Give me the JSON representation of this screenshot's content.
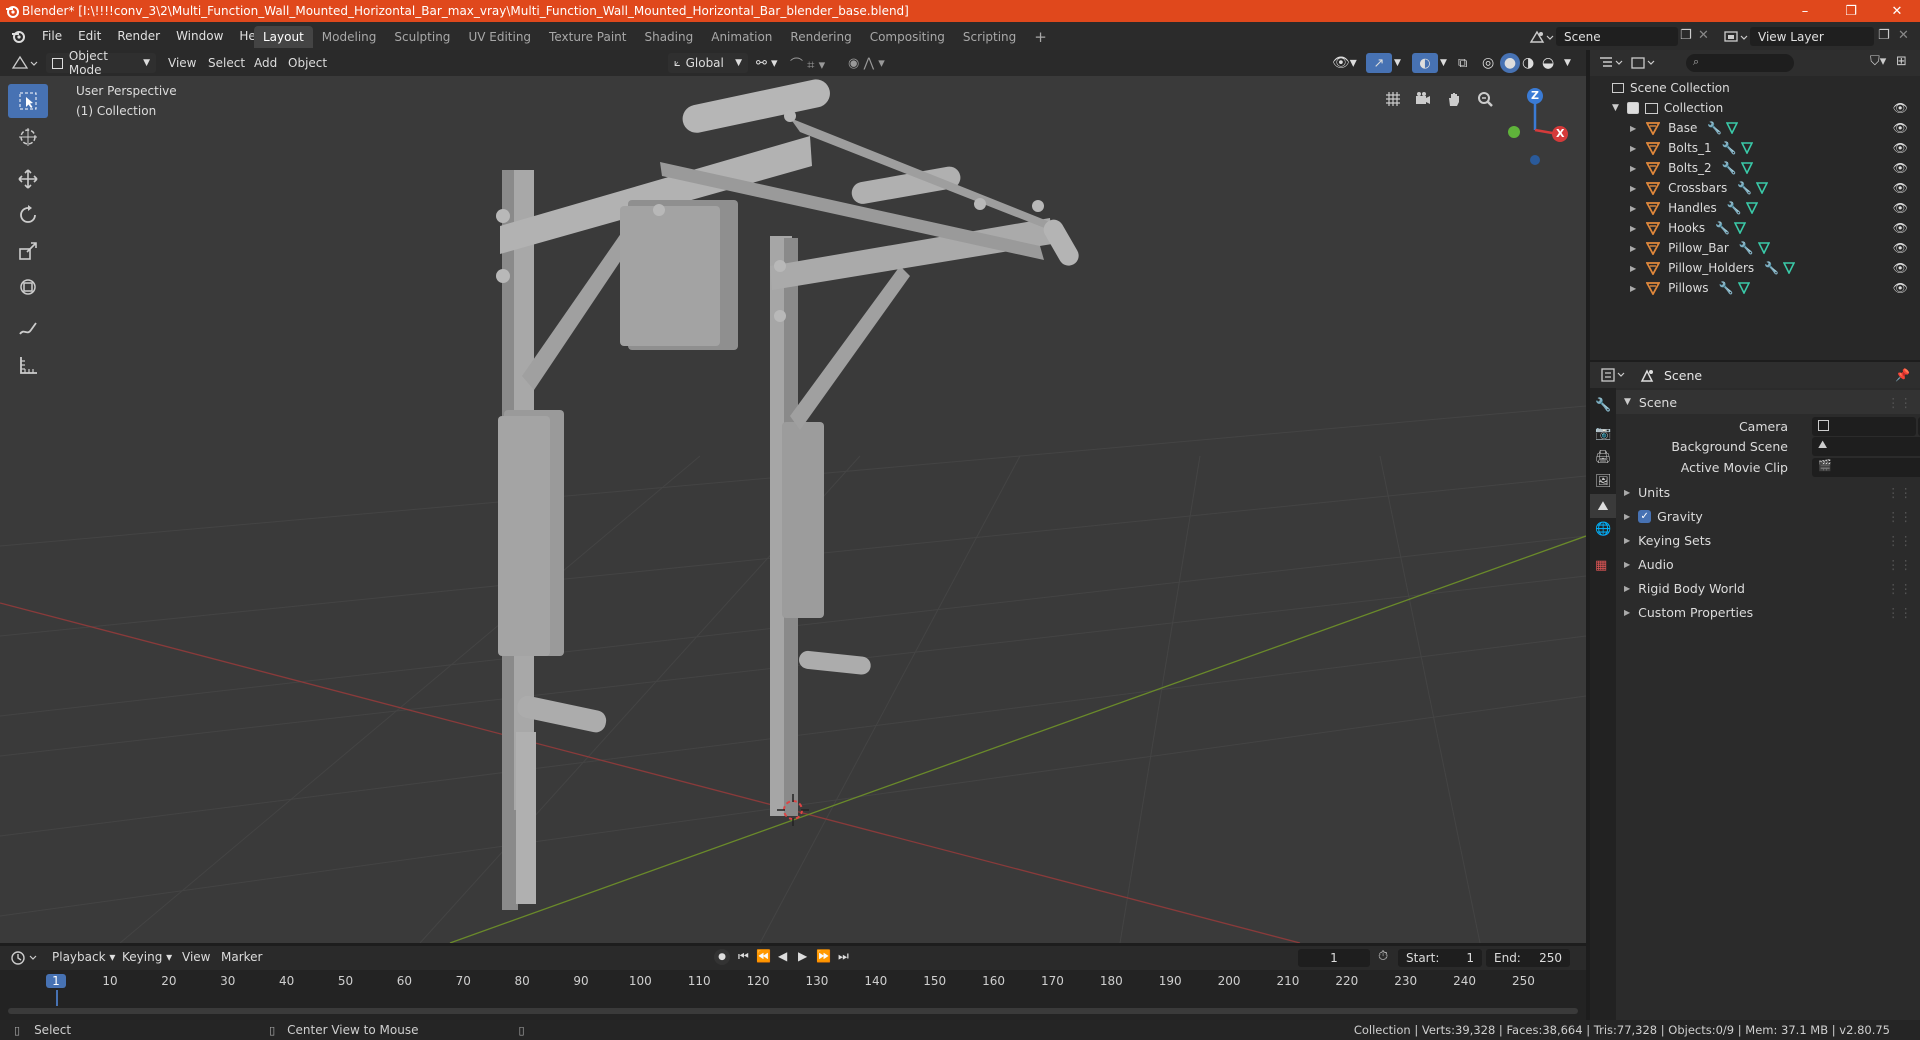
{
  "window": {
    "title": "Blender* [I:\\!!!!conv_3\\2\\Multi_Function_Wall_Mounted_Horizontal_Bar_max_vray\\Multi_Function_Wall_Mounted_Horizontal_Bar_blender_base.blend]",
    "controls": {
      "minimize": "–",
      "maximize": "❐",
      "close": "✕"
    }
  },
  "menu": {
    "items": [
      "File",
      "Edit",
      "Render",
      "Window",
      "Help"
    ]
  },
  "workspaces": {
    "tabs": [
      "Layout",
      "Modeling",
      "Sculpting",
      "UV Editing",
      "Texture Paint",
      "Shading",
      "Animation",
      "Rendering",
      "Compositing",
      "Scripting"
    ],
    "active": "Layout",
    "add": "+"
  },
  "scene_selector": {
    "value": "Scene"
  },
  "view_layer": {
    "value": "View Layer"
  },
  "viewport_header": {
    "mode": "Object Mode",
    "menus": [
      "View",
      "Select",
      "Add",
      "Object"
    ],
    "orientation": "Global"
  },
  "viewport": {
    "perspective": "User Perspective",
    "collection": "(1) Collection",
    "gizmo": {
      "z": "Z",
      "x": "X"
    }
  },
  "outliner": {
    "root": "Scene Collection",
    "collection": "Collection",
    "items": [
      "Base",
      "Bolts_1",
      "Bolts_2",
      "Crossbars",
      "Handles",
      "Hooks",
      "Pillow_Bar",
      "Pillow_Holders",
      "Pillows"
    ]
  },
  "properties": {
    "header_title": "Scene",
    "panel_title": "Scene",
    "fields": [
      {
        "label": "Camera"
      },
      {
        "label": "Background Scene"
      },
      {
        "label": "Active Movie Clip"
      }
    ],
    "sections": [
      "Units",
      "Gravity",
      "Keying Sets",
      "Audio",
      "Rigid Body World",
      "Custom Properties"
    ],
    "gravity_checked": true
  },
  "timeline": {
    "menus": [
      "Playback",
      "Keying",
      "View",
      "Marker"
    ],
    "current_frame": "1",
    "start_label": "Start:",
    "start": "1",
    "end_label": "End:",
    "end": "250",
    "ticks": [
      "1",
      "10",
      "20",
      "30",
      "40",
      "50",
      "60",
      "70",
      "80",
      "90",
      "100",
      "110",
      "120",
      "130",
      "140",
      "150",
      "160",
      "170",
      "180",
      "190",
      "200",
      "210",
      "220",
      "230",
      "240",
      "250"
    ]
  },
  "status": {
    "select": "Select",
    "center_view": "Center View to Mouse",
    "stats": "Collection | Verts:39,328 | Faces:38,664 | Tris:77,328 | Objects:0/9 | Mem: 37.1 MB | v2.80.75"
  },
  "colors": {
    "accent": "#4772b3",
    "titlebar": "#e0481c",
    "mesh_icon": "#e0883c",
    "modifier_icon": "#6fa8f0",
    "data_icon": "#3ac9a8"
  }
}
